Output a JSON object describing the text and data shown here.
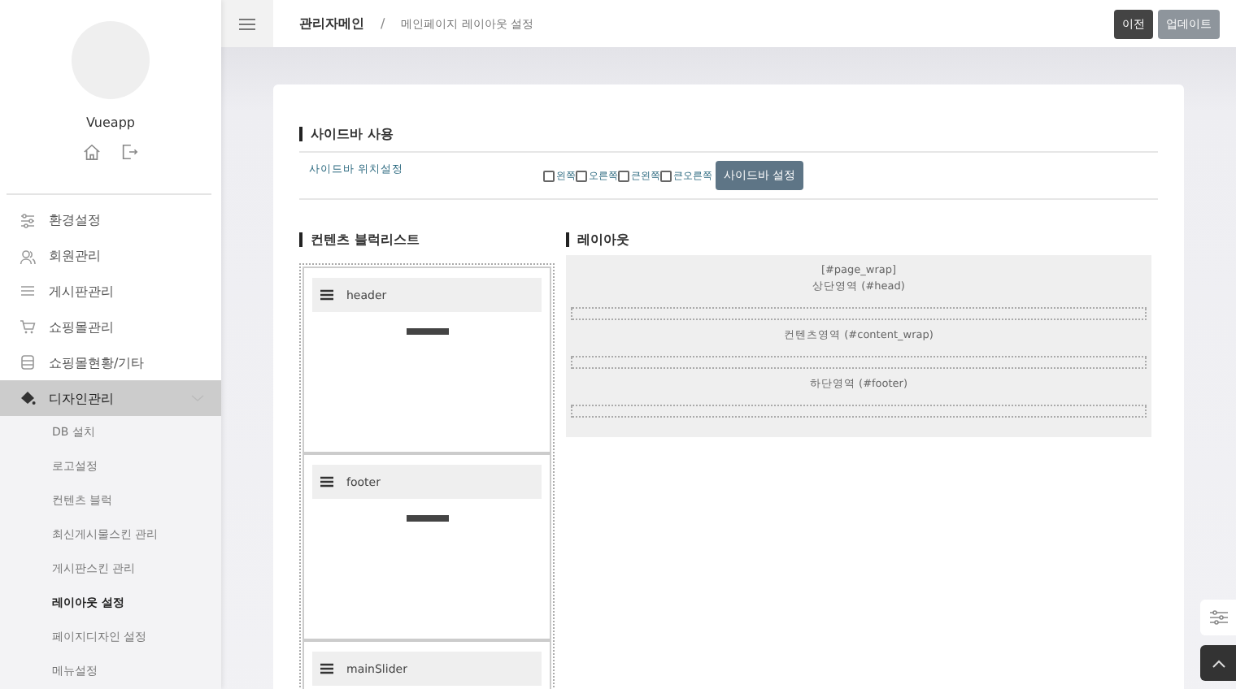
{
  "sidebar": {
    "profile_name": "Vueapp",
    "menu": [
      {
        "label": "환경설정",
        "expanded": false
      },
      {
        "label": "회원관리",
        "expanded": false
      },
      {
        "label": "게시판관리",
        "expanded": false
      },
      {
        "label": "쇼핑몰관리",
        "expanded": false
      },
      {
        "label": "쇼핑몰현황/기타",
        "expanded": false
      },
      {
        "label": "디자인관리",
        "expanded": true,
        "children": [
          {
            "label": "DB 설치",
            "selected": false
          },
          {
            "label": "로고설정",
            "selected": false
          },
          {
            "label": "컨텐츠 블럭",
            "selected": false
          },
          {
            "label": "최신게시물스킨 관리",
            "selected": false
          },
          {
            "label": "게시판스킨 관리",
            "selected": false
          },
          {
            "label": "레이아웃 설정",
            "selected": true
          },
          {
            "label": "페이지디자인 설정",
            "selected": false
          },
          {
            "label": "메뉴설정",
            "selected": false
          }
        ]
      }
    ]
  },
  "breadcrumb": {
    "home": "관리자메인",
    "separator": "/",
    "current": "메인페이지 레이아웃 설정"
  },
  "header_buttons": [
    {
      "label": "이전",
      "kind": "dark"
    },
    {
      "label": "업데이트",
      "kind": "muted"
    }
  ],
  "sidebar_section": {
    "title": "사이드바 사용",
    "field_label": "사이드바 위치설정",
    "options": [
      {
        "label": "왼쪽",
        "checked": false
      },
      {
        "label": "오른쪽",
        "checked": false
      },
      {
        "label": "큰왼쪽",
        "checked": false
      },
      {
        "label": "큰오른쪽",
        "checked": false
      }
    ],
    "button": "사이드바 설정"
  },
  "block_list": {
    "title": "컨텐츠 블럭리스트",
    "blocks": [
      {
        "name": "header"
      },
      {
        "name": "footer"
      },
      {
        "name": "mainSlider"
      }
    ]
  },
  "layout": {
    "title": "레이아웃",
    "wrap_label": "[#page_wrap]",
    "areas": [
      "상단영역 (#head)",
      "컨텐츠영역 (#content_wrap)",
      "하단영역 (#footer)"
    ]
  }
}
